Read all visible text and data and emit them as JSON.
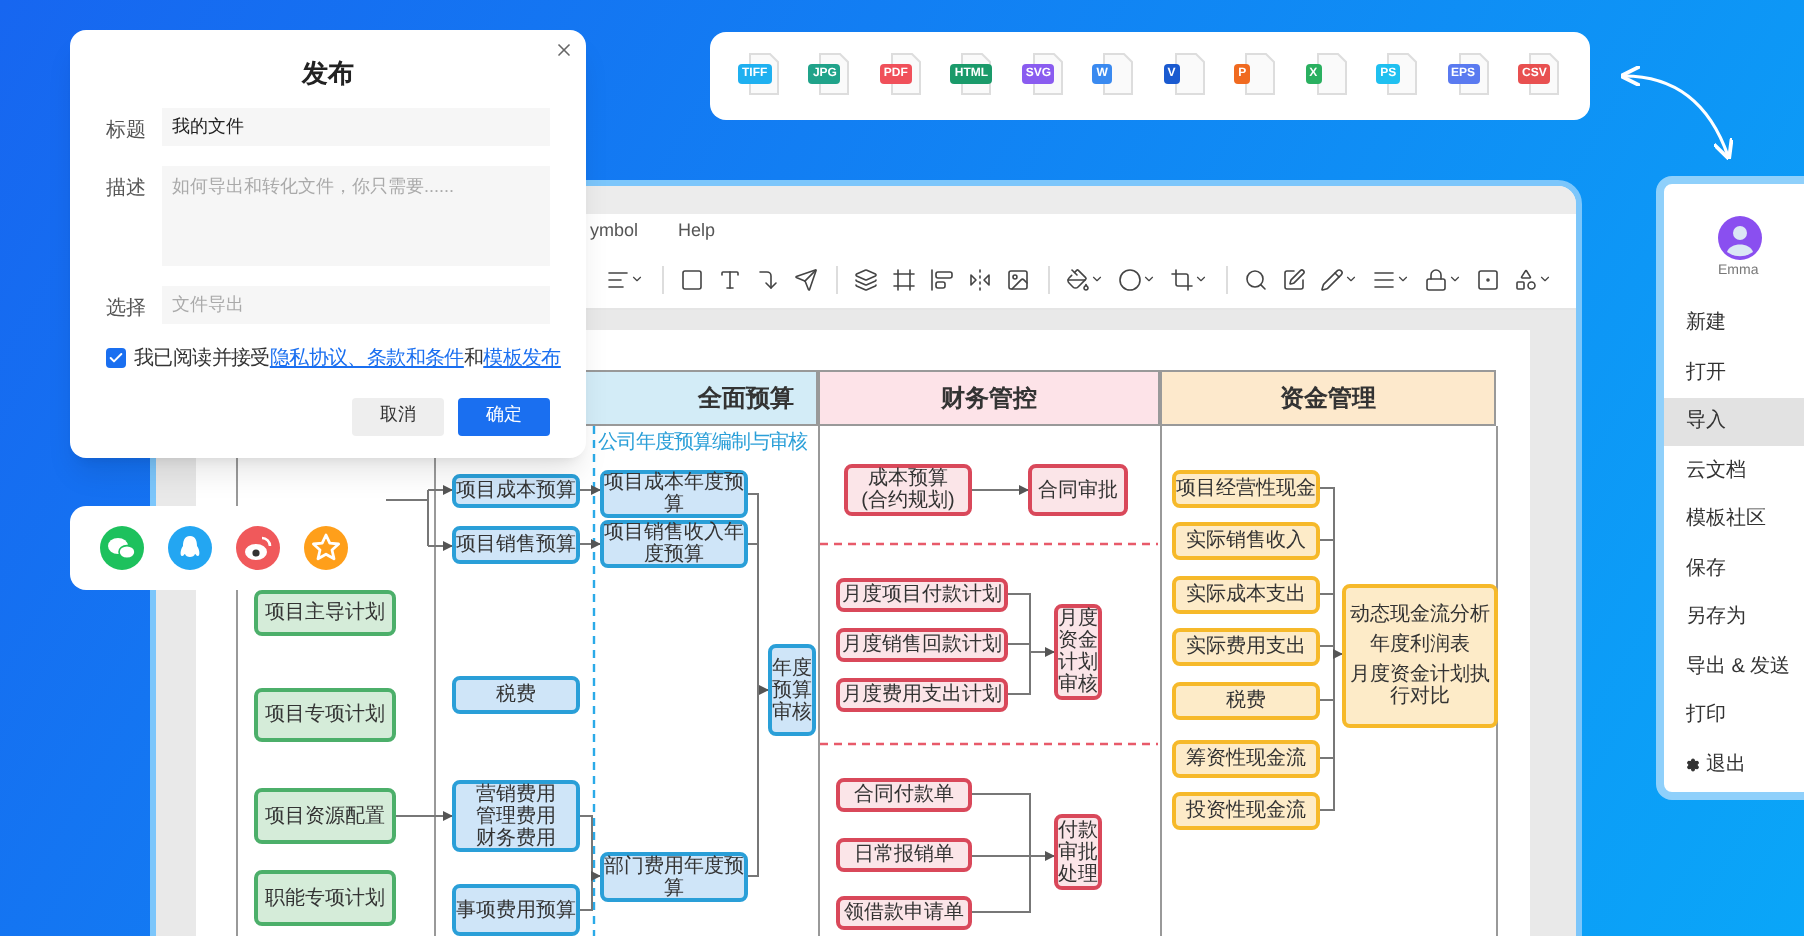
{
  "export_formats": [
    {
      "label": "TIFF",
      "color": "#1fb0f0"
    },
    {
      "label": "JPG",
      "color": "#20a38a"
    },
    {
      "label": "PDF",
      "color": "#f0505a"
    },
    {
      "label": "HTML",
      "color": "#1a9a6a"
    },
    {
      "label": "SVG",
      "color": "#8a5cf0"
    },
    {
      "label": "W",
      "color": "#3a8af0"
    },
    {
      "label": "V",
      "color": "#1a5ad0"
    },
    {
      "label": "P",
      "color": "#f06a20"
    },
    {
      "label": "X",
      "color": "#2ab060"
    },
    {
      "label": "PS",
      "color": "#20c0f0"
    },
    {
      "label": "EPS",
      "color": "#5a7af0"
    },
    {
      "label": "CSV",
      "color": "#e85050"
    }
  ],
  "app": {
    "menu": [
      "ymbol",
      "Help"
    ],
    "lanes": [
      {
        "title": "全面预算",
        "color": "#d3ecf7",
        "subtitle": "公司年度预算编制与审核"
      },
      {
        "title": "财务管控",
        "color": "#fde3e8"
      },
      {
        "title": "资金管理",
        "color": "#fde9cc"
      }
    ],
    "nodes": [
      {
        "kind": "plan",
        "label": "项目主导计划"
      },
      {
        "kind": "plan",
        "label": "项目专项计划"
      },
      {
        "kind": "plan",
        "label": "项目资源配置"
      },
      {
        "kind": "plan",
        "label": "职能专项计划"
      },
      {
        "kind": "budget",
        "label": "项目成本预算"
      },
      {
        "kind": "budget",
        "label": "项目销售预算"
      },
      {
        "kind": "budget",
        "label": "税费"
      },
      {
        "kind": "budget",
        "lines": [
          "营销费用",
          "管理费用",
          "财务费用"
        ]
      },
      {
        "kind": "budget",
        "label": "事项费用预算"
      },
      {
        "kind": "budget",
        "label": "项目成本年度预算"
      },
      {
        "kind": "budget",
        "label": "项目销售收入年度预算"
      },
      {
        "kind": "budget",
        "label": "部门费用年度预算"
      },
      {
        "kind": "budget",
        "label": "年度预算审核"
      },
      {
        "kind": "control",
        "lines": [
          "成本预算",
          "(合约规划)"
        ]
      },
      {
        "kind": "control",
        "label": "合同审批"
      },
      {
        "kind": "control",
        "label": "月度项目付款计划"
      },
      {
        "kind": "control",
        "label": "月度销售回款计划"
      },
      {
        "kind": "control",
        "label": "月度费用支出计划"
      },
      {
        "kind": "control",
        "label": "月度资金计划审核"
      },
      {
        "kind": "control",
        "label": "合同付款单"
      },
      {
        "kind": "control",
        "label": "日常报销单"
      },
      {
        "kind": "control",
        "label": "领借款申请单"
      },
      {
        "kind": "control",
        "label": "付款审批处理"
      },
      {
        "kind": "cash",
        "label": "项目经营性现金"
      },
      {
        "kind": "cash",
        "label": "实际销售收入"
      },
      {
        "kind": "cash",
        "label": "实际成本支出"
      },
      {
        "kind": "cash",
        "label": "实际费用支出"
      },
      {
        "kind": "cash",
        "label": "税费"
      },
      {
        "kind": "cash",
        "label": "筹资性现金流"
      },
      {
        "kind": "cash",
        "label": "投资性现金流"
      },
      {
        "kind": "cash",
        "lines": [
          "动态现金流分析",
          "年度利润表",
          "月度资金计划执行对比"
        ]
      }
    ]
  },
  "dialog": {
    "title": "发布",
    "fields": [
      {
        "kind": "input",
        "label": "标题",
        "value": "我的文件"
      },
      {
        "kind": "textarea",
        "label": "描述",
        "placeholder": "如何导出和转化文件，你只需要......"
      },
      {
        "kind": "input",
        "label": "选择",
        "placeholder": "文件导出"
      }
    ],
    "agreement": {
      "checked": true,
      "parts": [
        {
          "kind": "text",
          "text": "我已阅读并接受"
        },
        {
          "kind": "link",
          "text": "隐私协议、条款和条件"
        },
        {
          "kind": "text",
          "text": "和"
        },
        {
          "kind": "link",
          "text": "模板发布"
        }
      ]
    },
    "buttons": [
      {
        "label": "取消",
        "primary": false
      },
      {
        "label": "确定",
        "primary": true
      }
    ]
  },
  "side_menu": {
    "user": "Emma",
    "items": [
      {
        "label": "新建",
        "selected": false,
        "kind": "plain"
      },
      {
        "label": "打开",
        "selected": false,
        "kind": "plain"
      },
      {
        "label": "导入",
        "selected": true,
        "kind": "plain"
      },
      {
        "label": "云文档",
        "selected": false,
        "kind": "plain"
      },
      {
        "label": "模板社区",
        "selected": false,
        "kind": "plain"
      },
      {
        "label": "保存",
        "selected": false,
        "kind": "plain"
      },
      {
        "label": "另存为",
        "selected": false,
        "kind": "plain"
      },
      {
        "label": "导出 & 发送",
        "selected": false,
        "kind": "plain"
      },
      {
        "label": "打印",
        "selected": false,
        "kind": "plain"
      },
      {
        "label": "退出",
        "selected": false,
        "kind": "exit"
      }
    ]
  }
}
